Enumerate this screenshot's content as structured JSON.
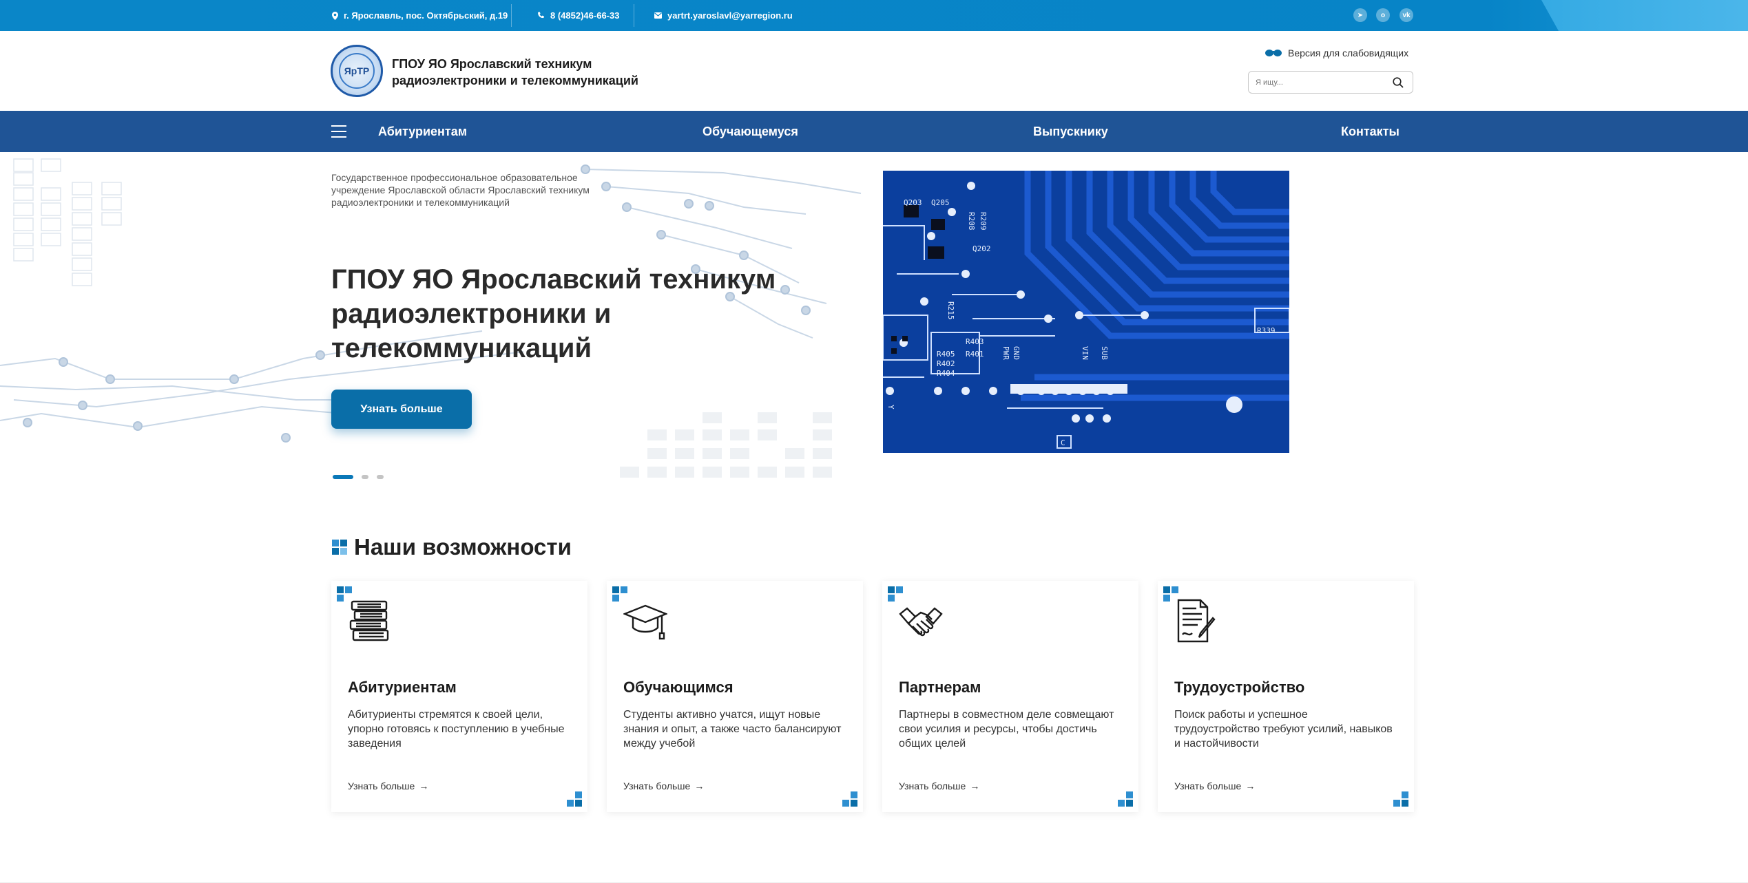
{
  "topbar": {
    "address": "г. Ярославль, пос. Октябрьский, д.19",
    "phone": "8 (4852)46-66-33",
    "email": "yartrt.yaroslavl@yarregion.ru",
    "social": [
      "t",
      "o",
      "vk"
    ]
  },
  "header": {
    "logo_text": "ЯрТР",
    "title_line1": "ГПОУ ЯО Ярославский техникум",
    "title_line2": "радиоэлектроники и телекоммуникаций",
    "visually_impaired": "Версия для слабовидящих",
    "search_placeholder": "Я ищу..."
  },
  "nav": {
    "items": [
      "Абитуриентам",
      "Обучающемуся",
      "Выпускнику",
      "Контакты"
    ]
  },
  "hero": {
    "subtitle": "Государственное профессиональное образовательное учреждение Ярославской области Ярославский техникум радиоэлектроники и телекоммуникаций",
    "title": "ГПОУ ЯО Ярославский техникум радиоэлектроники и телекоммуникаций",
    "button": "Узнать больше",
    "board_labels": [
      "Q203",
      "Q205",
      "R208",
      "R209",
      "Q202",
      "R215",
      "R403",
      "R405",
      "R401",
      "R402",
      "R404",
      "R339",
      "C",
      "GND",
      "PWR",
      "SUB",
      "VIN",
      "Y"
    ],
    "slides": 3,
    "active_slide": 1
  },
  "features": {
    "title": "Наши возможности",
    "cards": [
      {
        "icon": "books-icon",
        "title": "Абитуриентам",
        "text": "Абитуриенты стремятся к своей цели, упорно готовясь к поступлению в учебные заведения",
        "link": "Узнать больше"
      },
      {
        "icon": "graduation-cap-icon",
        "title": "Обучающимся",
        "text": "Студенты активно учатся, ищут новые знания и опыт, а также часто балансируют между учебой",
        "link": "Узнать больше"
      },
      {
        "icon": "handshake-icon",
        "title": "Партнерам",
        "text": "Партнеры в совместном деле совмещают свои усилия и ресурсы, чтобы достичь общих целей",
        "link": "Узнать больше"
      },
      {
        "icon": "contract-icon",
        "title": "Трудоустройство",
        "text": "Поиск работы и успешное трудоустройство требуют усилий, навыков и настойчивости",
        "link": "Узнать больше"
      }
    ]
  },
  "colors": {
    "topbar": "#0784c7",
    "nav": "#1f5496",
    "accent": "#0a6ea8",
    "board": "#0b3f9e"
  }
}
